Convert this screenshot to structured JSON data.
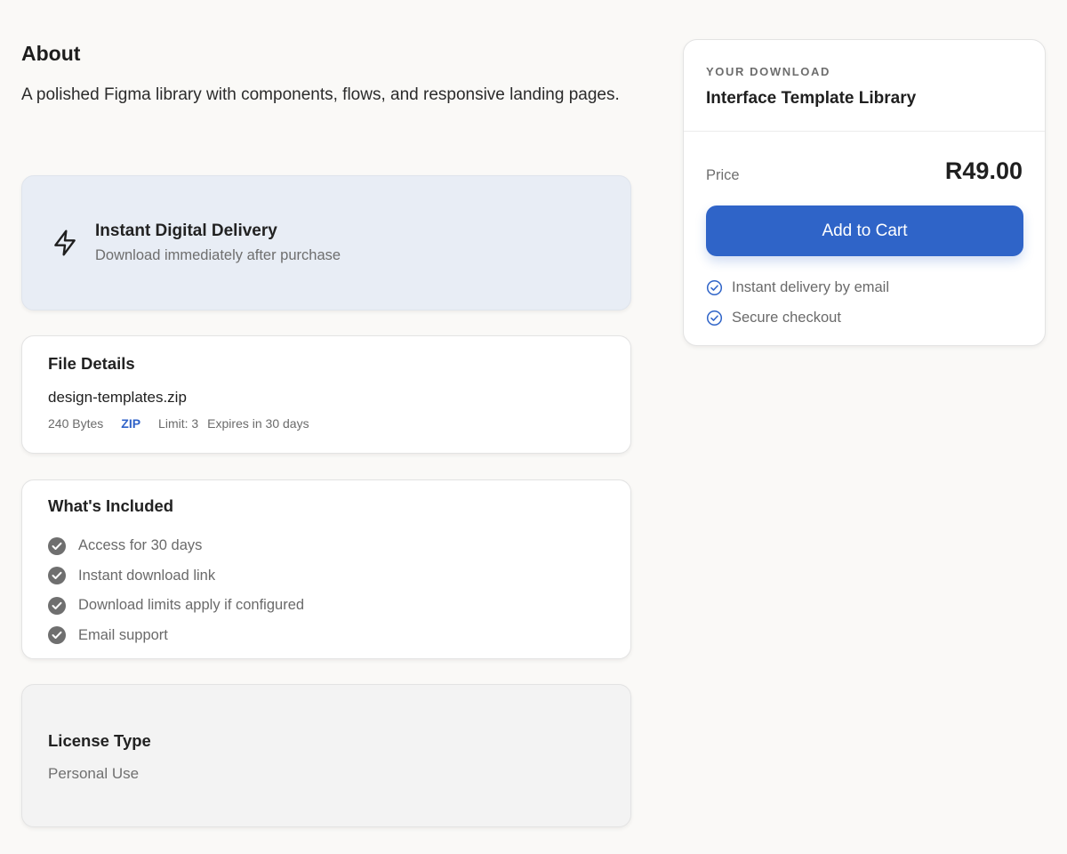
{
  "about": {
    "title": "About",
    "description": "A polished Figma library with components, flows, and responsive landing pages."
  },
  "delivery": {
    "icon": "bolt-icon",
    "title": "Instant Digital Delivery",
    "subtitle": "Download immediately after purchase"
  },
  "file_details": {
    "title": "File Details",
    "file_name": "design-templates.zip",
    "size": "240 Bytes",
    "type": "ZIP",
    "limit": "Limit: 3",
    "expires": "Expires in 30 days"
  },
  "included": {
    "title": "What's Included",
    "items": [
      "Access for 30 days",
      "Instant download link",
      "Download limits apply if configured",
      "Email support"
    ]
  },
  "license": {
    "title": "License Type",
    "value": "Personal Use"
  },
  "purchase": {
    "eyebrow": "YOUR DOWNLOAD",
    "product": "Interface Template Library",
    "price_label": "Price",
    "price": "R49.00",
    "button": "Add to Cart",
    "benefits": [
      "Instant delivery by email",
      "Secure checkout"
    ]
  },
  "colors": {
    "accent": "#2f64c8",
    "page_bg": "#faf9f7",
    "delivery_bg": "#e8edf5",
    "license_bg": "#f3f3f3"
  }
}
